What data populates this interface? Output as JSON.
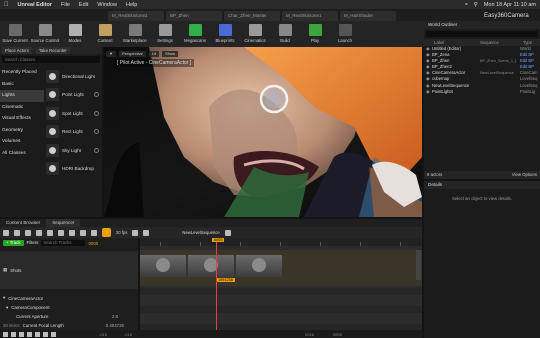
{
  "menubar": {
    "app": "Unreal Editor",
    "items": [
      "File",
      "Edit",
      "Window",
      "Help"
    ],
    "datetime": "Mon 18 Apr  11:10 am"
  },
  "tabs": [
    "M_RealSkintone2",
    "BP_Zhen",
    "Char_Zhen_Master",
    "M_RealSkintone1",
    "M_HairShader"
  ],
  "project_name": "Easy360Camera",
  "toolbar": [
    "Save Current",
    "Source Control",
    "Modes",
    "Content",
    "Marketplace",
    "Settings",
    "Megascans",
    "Blueprints",
    "Cinematics",
    "Build",
    "Play",
    "Launch"
  ],
  "place_actors": {
    "tabs": [
      "Place Actors",
      "Take Recorder"
    ],
    "search_placeholder": "Search Classes",
    "categories": [
      "Recently Placed",
      "Basic",
      "Lights",
      "Cinematic",
      "Visual Effects",
      "Geometry",
      "Volumes",
      "All Classes"
    ],
    "selected_category": "Lights",
    "items": [
      "Directional Light",
      "Point Light",
      "Spot Light",
      "Rect Light",
      "Sky Light",
      "HDRI Backdrop"
    ]
  },
  "viewport": {
    "buttons": [
      "Perspective",
      "Lit",
      "Show"
    ],
    "pilot_label": "[ Pilot Active - CineCameraActor ]"
  },
  "world_outliner": {
    "title": "World Outliner",
    "columns": [
      "Label",
      "Sequence",
      "Type"
    ],
    "rows": [
      {
        "label": "Untitled (Editor)",
        "sequence": "",
        "type": "World"
      },
      {
        "label": "BP_Zena",
        "sequence": "",
        "type": "Edit BP"
      },
      {
        "label": "BP_Zhen",
        "sequence": "BP_Zhen_Scene_1_[",
        "type": "Edit BP"
      },
      {
        "label": "BP_Zhen2",
        "sequence": "",
        "type": "Edit BP"
      },
      {
        "label": "CineCameraActor",
        "sequence": "NewLevelSequence",
        "type": "CineCam"
      },
      {
        "label": "cubemap",
        "sequence": "",
        "type": "LevelSeq"
      },
      {
        "label": "NewLevelSequence",
        "sequence": "",
        "type": "LevelSeq"
      },
      {
        "label": "PointLight4",
        "sequence": "",
        "type": "PointLig"
      }
    ],
    "actor_count": "8 actors",
    "view_options": "View Options"
  },
  "details": {
    "title": "Details",
    "empty_message": "Select an object to view details."
  },
  "sequencer": {
    "tabs": [
      "Content Browser",
      "Sequencer"
    ],
    "fps": "30 fps",
    "sequence_name": "NewLevelSequence",
    "add_track": "+ Track",
    "filters": "Filters",
    "search_placeholder": "Search Tracks",
    "start_frame": "0000",
    "playhead_frame": "0005",
    "clip_label": "1991238",
    "tracks": [
      "Shots",
      "CineCameraActor",
      "CameraComponent",
      "Current Aperture",
      "Current Focal Length"
    ],
    "track_values": {
      "current_aperture": "2.8",
      "current_focal_length": "0.404726"
    },
    "fps_short": "30 items",
    "ruler_labels": [
      "-015",
      "-015",
      "0016",
      "0055"
    ]
  }
}
